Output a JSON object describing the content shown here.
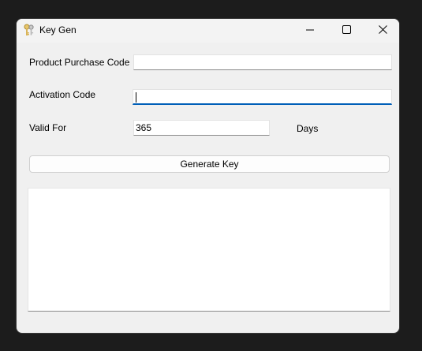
{
  "window": {
    "title": "Key Gen"
  },
  "form": {
    "product_code_label": "Product Purchase Code",
    "product_code_value": "",
    "activation_code_label": "Activation Code",
    "activation_code_value": "",
    "valid_for_label": "Valid For",
    "valid_for_value": "365",
    "days_label": "Days"
  },
  "actions": {
    "generate_label": "Generate Key"
  },
  "output": {
    "text": ""
  },
  "colors": {
    "focus_accent": "#005fb8",
    "window_bg": "#f0f0f0"
  },
  "icons": {
    "app": "keys-icon",
    "minimize": "minimize-icon",
    "maximize": "maximize-icon",
    "close": "close-icon"
  }
}
